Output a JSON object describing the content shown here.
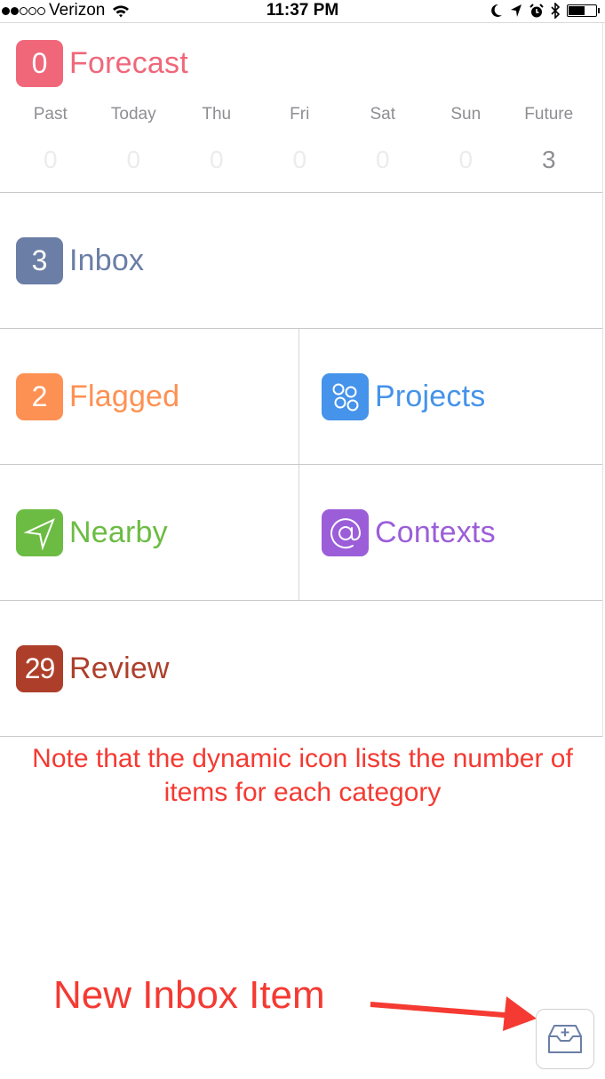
{
  "status_bar": {
    "signal_filled": 2,
    "signal_total": 5,
    "carrier": "Verizon",
    "time": "11:37 PM",
    "icons": [
      "wifi-icon",
      "moon-icon",
      "location-arrow-icon",
      "alarm-icon",
      "bluetooth-icon",
      "battery-icon"
    ],
    "battery_level": 0.55
  },
  "forecast": {
    "badge": "0",
    "label": "Forecast",
    "color": "#f0677a",
    "days": [
      {
        "name": "Past",
        "count": "0"
      },
      {
        "name": "Today",
        "count": "0"
      },
      {
        "name": "Thu",
        "count": "0"
      },
      {
        "name": "Fri",
        "count": "0"
      },
      {
        "name": "Sat",
        "count": "0"
      },
      {
        "name": "Sun",
        "count": "0"
      },
      {
        "name": "Future",
        "count": "3"
      }
    ]
  },
  "perspectives": {
    "inbox": {
      "badge": "3",
      "label": "Inbox",
      "color": "#6b7ea6"
    },
    "flagged": {
      "badge": "2",
      "label": "Flagged",
      "color": "#fd9153"
    },
    "projects": {
      "icon": "projects-circles-icon",
      "label": "Projects",
      "color": "#4593ea"
    },
    "nearby": {
      "icon": "location-arrow-icon",
      "label": "Nearby",
      "color": "#6cbc43"
    },
    "contexts": {
      "icon": "at-sign-icon",
      "label": "Contexts",
      "color": "#9b5ed8"
    },
    "review": {
      "badge": "29",
      "label": "Review",
      "color": "#ad3f2a"
    }
  },
  "annotations": {
    "note": "Note that the dynamic icon lists the number of items for each category",
    "new_inbox_label": "New Inbox Item",
    "color": "#f43a32"
  },
  "new_inbox_button": {
    "icon": "inbox-tray-plus-icon"
  }
}
